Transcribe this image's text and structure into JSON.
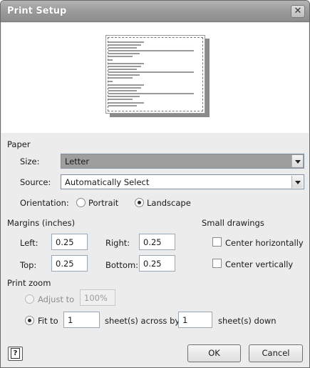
{
  "window": {
    "title": "Print Setup"
  },
  "paper": {
    "section_label": "Paper",
    "size_label": "Size:",
    "size_value": "Letter",
    "source_label": "Source:",
    "source_value": "Automatically Select",
    "orientation_label": "Orientation:",
    "portrait_label": "Portrait",
    "landscape_label": "Landscape",
    "orientation_selected": "Landscape"
  },
  "margins": {
    "section_label": "Margins (inches)",
    "left_label": "Left:",
    "left_value": "0.25",
    "right_label": "Right:",
    "right_value": "0.25",
    "top_label": "Top:",
    "top_value": "0.25",
    "bottom_label": "Bottom:",
    "bottom_value": "0.25"
  },
  "small_drawings": {
    "section_label": "Small drawings",
    "center_horizontally_label": "Center horizontally",
    "center_vertically_label": "Center vertically"
  },
  "print_zoom": {
    "section_label": "Print zoom",
    "adjust_to_label": "Adjust to",
    "adjust_to_value": "100%",
    "fit_to_label": "Fit to",
    "fit_across_value": "1",
    "across_label": "sheet(s) across by",
    "fit_down_value": "1",
    "down_label": "sheet(s) down"
  },
  "buttons": {
    "ok_label": "OK",
    "cancel_label": "Cancel"
  },
  "icons": {
    "close": "close-icon",
    "help": "help-icon",
    "dropdown": "chevron-down-icon"
  }
}
